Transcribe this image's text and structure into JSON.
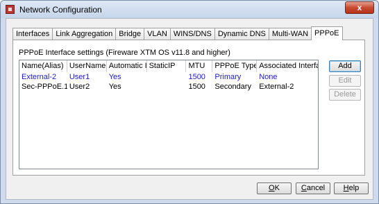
{
  "window": {
    "title": "Network Configuration",
    "close_label": "x"
  },
  "tabs": [
    {
      "label": "Interfaces",
      "active": false
    },
    {
      "label": "Link Aggregation",
      "active": false
    },
    {
      "label": "Bridge",
      "active": false
    },
    {
      "label": "VLAN",
      "active": false
    },
    {
      "label": "WINS/DNS",
      "active": false
    },
    {
      "label": "Dynamic DNS",
      "active": false
    },
    {
      "label": "Multi-WAN",
      "active": false
    },
    {
      "label": "PPPoE",
      "active": true
    }
  ],
  "panel": {
    "label": "PPPoE Interface settings (Fireware XTM OS v11.8 and higher)"
  },
  "table": {
    "columns": [
      "Name(Alias)",
      "UserName",
      "Automatic IP",
      "StaticIP",
      "MTU",
      "PPPoE Type",
      "Associated Interface"
    ],
    "rows": [
      {
        "name": "External-2",
        "username": "User1",
        "automatic_ip": "Yes",
        "static_ip": "",
        "mtu": "1500",
        "type": "Primary",
        "associated": "None"
      },
      {
        "name": "Sec-PPPoE.1",
        "username": "User2",
        "automatic_ip": "Yes",
        "static_ip": "",
        "mtu": "1500",
        "type": "Secondary",
        "associated": "External-2"
      }
    ]
  },
  "side_buttons": {
    "add": "Add",
    "edit": "Edit",
    "delete": "Delete"
  },
  "footer_buttons": {
    "ok_first": "O",
    "ok_rest": "K",
    "cancel_first": "C",
    "cancel_rest": "ancel",
    "help_first": "H",
    "help_rest": "elp"
  },
  "colors": {
    "selected_row_text": "#1a1acc",
    "close_button": "#c84a2f"
  }
}
